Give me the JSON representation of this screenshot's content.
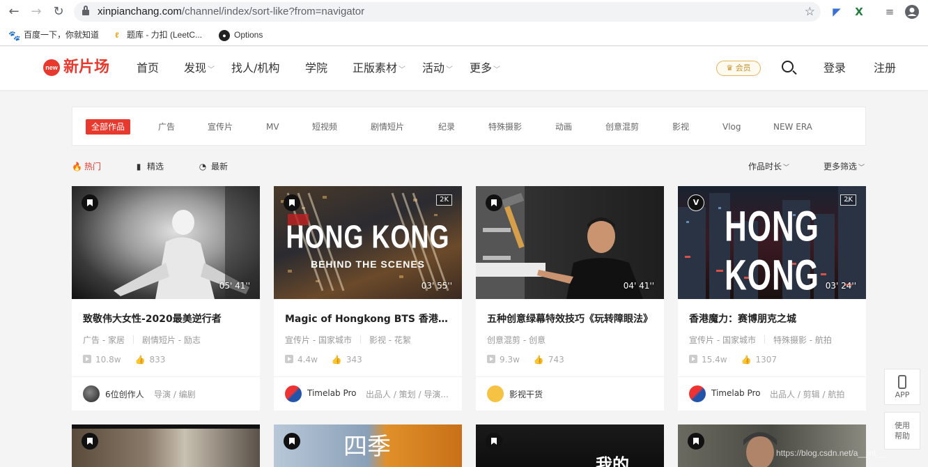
{
  "browser": {
    "url_host": "xinpianchang.com",
    "url_path": "/channel/index/sort-like?from=navigator",
    "bookmarks": [
      {
        "label": "百度一下，你就知道"
      },
      {
        "label": "题库 - 力扣 (LeetC..."
      },
      {
        "label": "Options"
      }
    ]
  },
  "header": {
    "logo_badge": "new",
    "logo_text": "新片场",
    "nav": [
      {
        "label": "首页"
      },
      {
        "label": "发现"
      },
      {
        "label": "找人/机构"
      },
      {
        "label": "学院"
      },
      {
        "label": "正版素材"
      },
      {
        "label": "活动"
      },
      {
        "label": "更多"
      }
    ],
    "vip_label": "会员",
    "login_label": "登录",
    "register_label": "注册"
  },
  "categories": [
    "全部作品",
    "广告",
    "宣传片",
    "MV",
    "短视频",
    "剧情短片",
    "纪录",
    "特殊摄影",
    "动画",
    "创意混剪",
    "影视",
    "Vlog",
    "NEW ERA"
  ],
  "sort": {
    "tabs": [
      {
        "label": "热门"
      },
      {
        "label": "精选"
      },
      {
        "label": "最新"
      }
    ],
    "duration_filter": "作品时长",
    "more_filter": "更多筛选"
  },
  "cards": [
    {
      "title": "致敬伟大女性-2020最美逆行者",
      "duration": "05' 41''",
      "resolution": "",
      "thumb_text": "",
      "tag1": "广告 - 家居",
      "tag2": "剧情短片 - 励志",
      "views": "10.8w",
      "likes": "833",
      "author": "6位创作人",
      "roles": "导演 / 编剧"
    },
    {
      "title": "Magic of Hongkong BTS 香港魔力幕后",
      "duration": "03' 55''",
      "resolution": "2K",
      "thumb_text": "HONG KONG",
      "thumb_sub": "BEHIND THE SCENES",
      "tag1": "宣传片 - 国家城市",
      "tag2": "影视 - 花絮",
      "views": "4.4w",
      "likes": "343",
      "author": "Timelab Pro",
      "roles": "出品人 / 策划 / 导演..."
    },
    {
      "title": "五种创意绿幕特效技巧《玩转障眼法》",
      "duration": "04' 41''",
      "resolution": "",
      "thumb_text": "",
      "tag1": "创意混剪 - 创意",
      "tag2": "",
      "views": "9.3w",
      "likes": "743",
      "author": "影视干货",
      "roles": ""
    },
    {
      "title": "香港魔力：赛博朋克之城",
      "duration": "03' 24''",
      "resolution": "2K",
      "thumb_text": "HONG KONG",
      "thumb_sub": "",
      "tag1": "宣传片 - 国家城市",
      "tag2": "特殊摄影 - 航拍",
      "views": "15.4w",
      "likes": "1307",
      "author": "Timelab Pro",
      "roles": "出品人 / 剪辑 / 航拍"
    }
  ],
  "second_row": [
    {
      "thumb_text": ""
    },
    {
      "thumb_text": "四季"
    },
    {
      "thumb_text": "我的"
    },
    {
      "thumb_text": ""
    }
  ],
  "side": {
    "app_label": "APP",
    "help_label_1": "使用",
    "help_label_2": "帮助"
  },
  "watermark": "https://blog.csdn.net/a__int__",
  "colors": {
    "brand": "#e7392e",
    "vip": "#c8922c"
  }
}
